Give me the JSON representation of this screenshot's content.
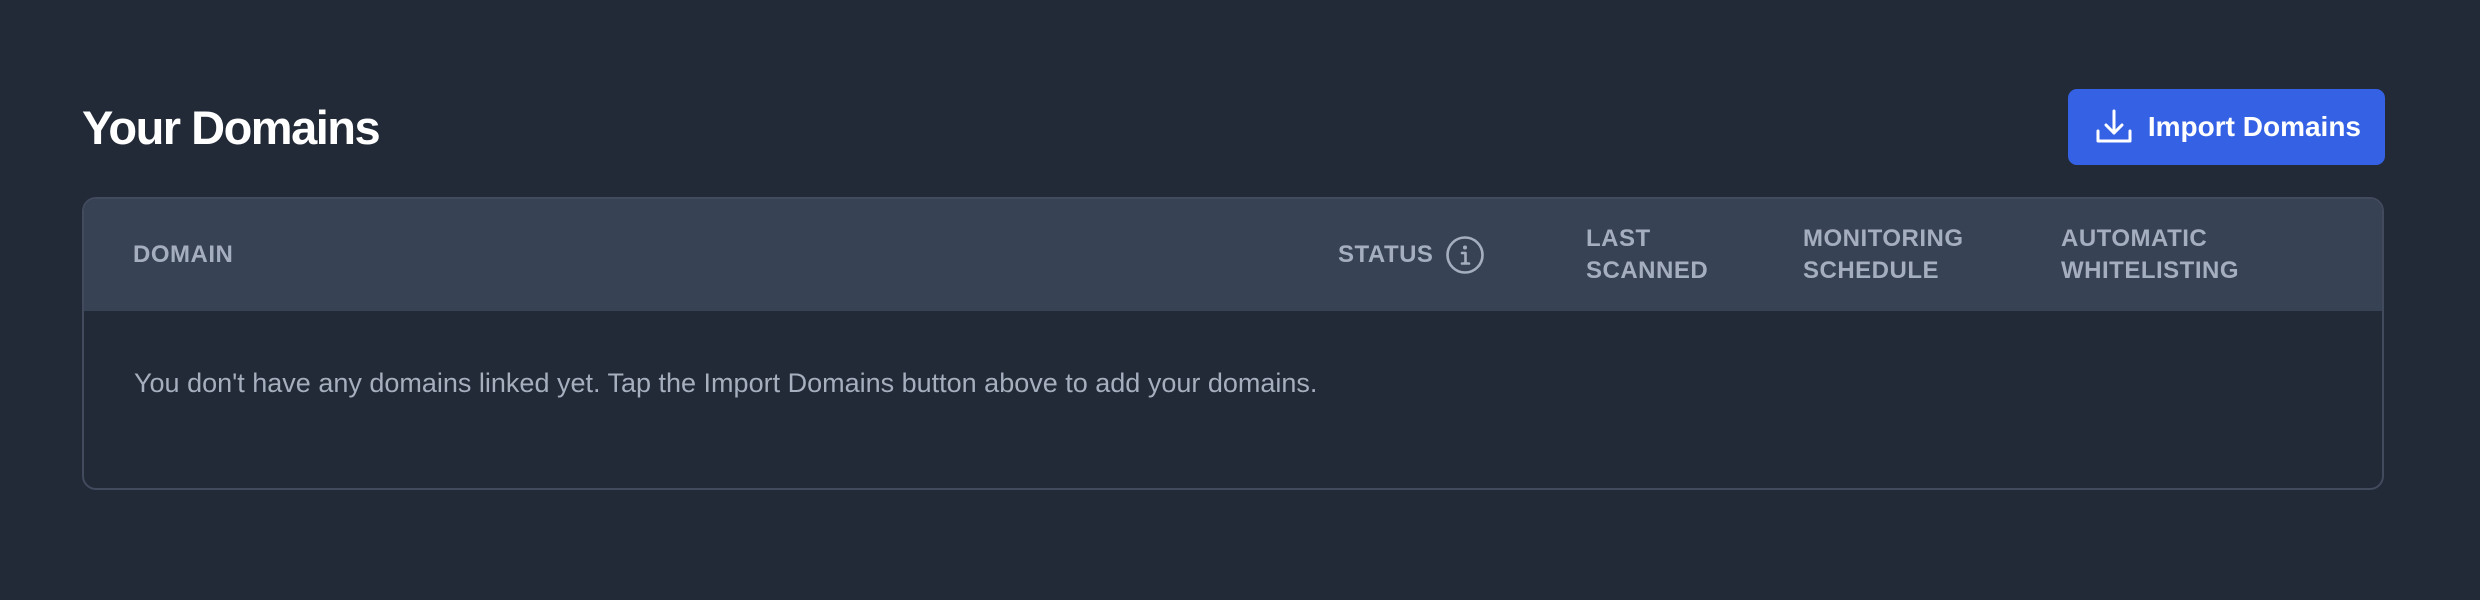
{
  "header": {
    "title": "Your Domains",
    "import_button_label": "Import Domains",
    "import_icon": "download-icon"
  },
  "table": {
    "columns": {
      "domain": "DOMAIN",
      "status": "STATUS",
      "last_scanned": "LAST\nSCANNED",
      "monitoring_schedule": "MONITORING\nSCHEDULE",
      "automatic_whitelisting": "AUTOMATIC\nWHITELISTING"
    },
    "status_icon": "info-icon",
    "empty_message": "You don't have any domains linked yet. Tap the Import Domains button above to add your domains."
  },
  "colors": {
    "background": "#222937",
    "header_row": "#374355",
    "accent": "#3562e5",
    "muted_text": "#a4aebe"
  }
}
